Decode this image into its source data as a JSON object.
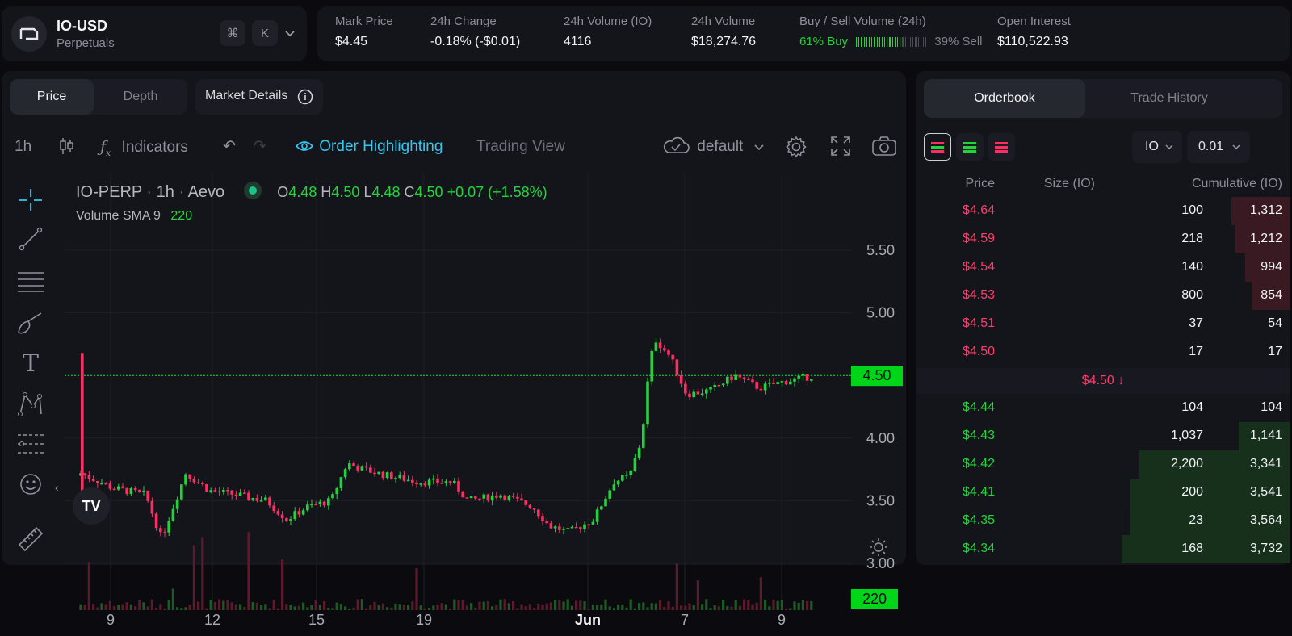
{
  "market": {
    "symbol": "IO-USD",
    "type": "Perpetuals",
    "cmd_label": "⌘",
    "k_label": "K"
  },
  "stats": [
    {
      "label": "Mark Price",
      "value": "$4.45",
      "color": "#ff3d6b"
    },
    {
      "label": "24h Change",
      "value": "-0.18% (-$0.01)",
      "color": "#ff3d6b"
    },
    {
      "label": "24h Volume (IO)",
      "value": "4116",
      "color": "#f2f3f5"
    },
    {
      "label": "24h Volume",
      "value": "$18,274.76",
      "color": "#f2f3f5"
    },
    {
      "label": "Buy / Sell Volume (24h)",
      "buy": "61% Buy",
      "sell": "39% Sell",
      "buy_fraction": 0.61
    },
    {
      "label": "Open Interest",
      "value": "$110,522.93",
      "color": "#f2f3f5"
    }
  ],
  "chart_tabs": {
    "price": "Price",
    "depth": "Depth",
    "market_details": "Market Details"
  },
  "toolbar": {
    "interval": "1h",
    "indicators": "Indicators",
    "order_highlighting": "Order Highlighting",
    "trading_view": "Trading View",
    "layout": "default"
  },
  "legend": {
    "name": "IO-PERP",
    "interval": "1h",
    "exchange": "Aevo",
    "o_label": "O",
    "o": "4.48",
    "h_label": "H",
    "h": "4.50",
    "l_label": "L",
    "l": "4.48",
    "c_label": "C",
    "c": "4.50",
    "change": "+0.07 (+1.58%)",
    "sma_label": "Volume SMA 9",
    "sma_value": "220"
  },
  "chart_data": {
    "type": "candlestick",
    "y_ticks": [
      "5.50",
      "5.00",
      "4.50",
      "4.00",
      "3.50",
      "3.00"
    ],
    "x_ticks": [
      "9",
      "12",
      "15",
      "19",
      "Jun",
      "7",
      "9"
    ],
    "last_price": "4.50",
    "last_volume": "220",
    "colors": {
      "up": "#22d43a",
      "down": "#ff2d63"
    }
  },
  "orderbook": {
    "tabs": {
      "orderbook": "Orderbook",
      "trades": "Trade History"
    },
    "unit": "IO",
    "tick": "0.01",
    "headers": {
      "price": "Price",
      "size": "Size (IO)",
      "cum": "Cumulative (IO)"
    },
    "asks": [
      {
        "price": "$4.64",
        "size": "100",
        "cum": "1,312",
        "depth": 0.352
      },
      {
        "price": "$4.59",
        "size": "218",
        "cum": "1,212",
        "depth": 0.325
      },
      {
        "price": "$4.54",
        "size": "140",
        "cum": "994",
        "depth": 0.266
      },
      {
        "price": "$4.53",
        "size": "800",
        "cum": "854",
        "depth": 0.229
      },
      {
        "price": "$4.51",
        "size": "37",
        "cum": "54",
        "depth": 0.0
      },
      {
        "price": "$4.50",
        "size": "17",
        "cum": "17",
        "depth": 0.0
      }
    ],
    "mid": "$4.50",
    "bids": [
      {
        "price": "$4.44",
        "size": "104",
        "cum": "104",
        "depth": 0.0
      },
      {
        "price": "$4.43",
        "size": "1,037",
        "cum": "1,141",
        "depth": 0.306
      },
      {
        "price": "$4.42",
        "size": "2,200",
        "cum": "3,341",
        "depth": 0.895
      },
      {
        "price": "$4.41",
        "size": "200",
        "cum": "3,541",
        "depth": 0.949
      },
      {
        "price": "$4.35",
        "size": "23",
        "cum": "3,564",
        "depth": 0.955
      },
      {
        "price": "$4.34",
        "size": "168",
        "cum": "3,732",
        "depth": 1.0
      }
    ]
  }
}
